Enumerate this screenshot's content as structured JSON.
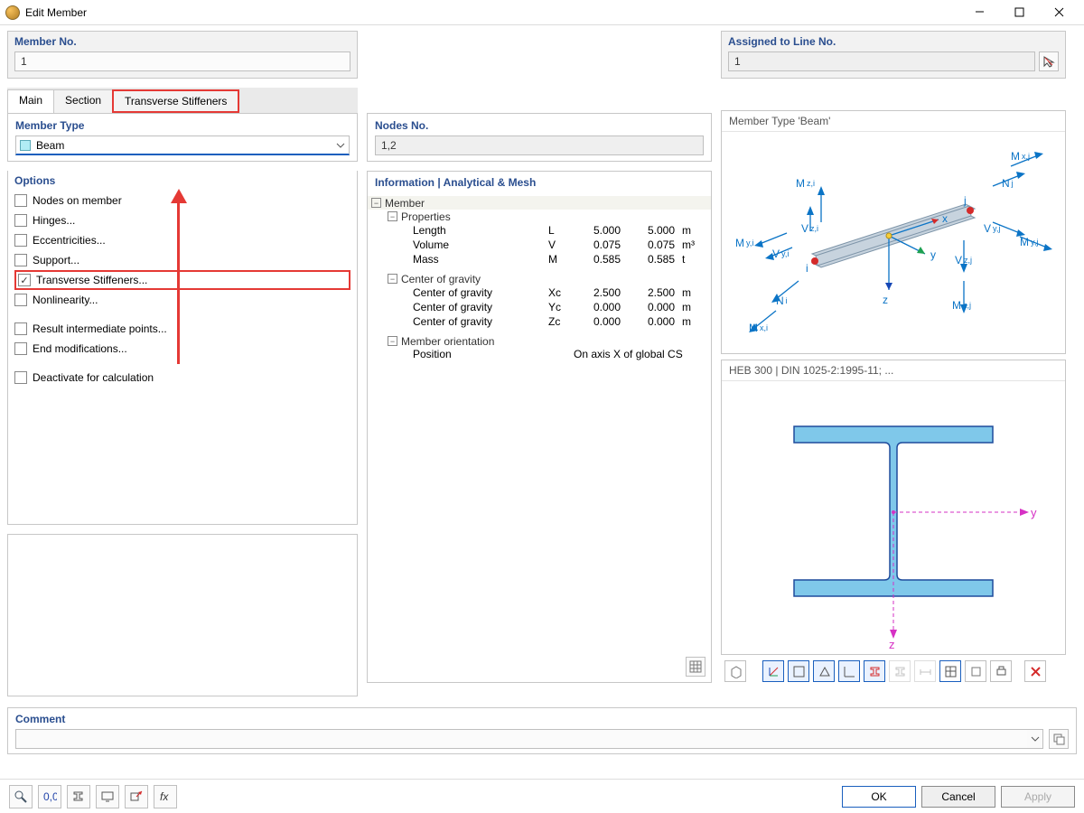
{
  "window": {
    "title": "Edit Member"
  },
  "member_no": {
    "title": "Member No.",
    "value": "1"
  },
  "assigned": {
    "title": "Assigned to Line No.",
    "value": "1"
  },
  "tabs": {
    "main": "Main",
    "section": "Section",
    "stiff": "Transverse Stiffeners"
  },
  "member_type": {
    "title": "Member Type",
    "value": "Beam"
  },
  "options": {
    "title": "Options",
    "nodes_on_member": "Nodes on member",
    "hinges": "Hinges...",
    "eccentricities": "Eccentricities...",
    "support": "Support...",
    "transverse_stiffeners": "Transverse Stiffeners...",
    "nonlinearity": "Nonlinearity...",
    "result_intermediate": "Result intermediate points...",
    "end_modifications": "End modifications...",
    "deactivate": "Deactivate for calculation"
  },
  "nodes_no": {
    "title": "Nodes No.",
    "value": "1,2"
  },
  "info": {
    "title": "Information | Analytical & Mesh",
    "member": "Member",
    "properties": "Properties",
    "length": "Length",
    "length_sym": "L",
    "length_v1": "5.000",
    "length_v2": "5.000",
    "length_u": "m",
    "volume": "Volume",
    "volume_sym": "V",
    "volume_v1": "0.075",
    "volume_v2": "0.075",
    "volume_u": "m³",
    "mass": "Mass",
    "mass_sym": "M",
    "mass_v1": "0.585",
    "mass_v2": "0.585",
    "mass_u": "t",
    "cog": "Center of gravity",
    "xc": "Xc",
    "yc": "Yc",
    "zc": "Zc",
    "cog_x1": "2.500",
    "cog_x2": "2.500",
    "cog_xu": "m",
    "cog_y1": "0.000",
    "cog_y2": "0.000",
    "cog_yu": "m",
    "cog_z1": "0.000",
    "cog_z2": "0.000",
    "cog_zu": "m",
    "orientation": "Member orientation",
    "position_lbl": "Position",
    "position_val": "On axis X of global CS"
  },
  "preview1": {
    "title": "Member Type 'Beam'",
    "Mzi": "M",
    "Mzisub": "z,i",
    "Vzi": "V",
    "Vzisub": "z,i",
    "Myi": "M",
    "Myisub": "y,i",
    "Vyi": "V",
    "Vyisub": "y,i",
    "Ni": "N",
    "Nisub": "i",
    "Mxi": "M",
    "Mxisub": "x,i",
    "Mxj": "M",
    "Mxjsub": "x,j",
    "Nj": "N",
    "Njsub": "j",
    "Vyj": "V",
    "Vyjsub": "y,j",
    "Myj": "M",
    "Myjsub": "y,j",
    "Vzj": "V",
    "Vzjsub": "z,j",
    "Mzj": "M",
    "Mzjsub": "z,j",
    "x": "x",
    "y": "y",
    "z": "z",
    "i": "i",
    "j": "j"
  },
  "preview2": {
    "title": "HEB 300 | DIN 1025-2:1995-11; ...",
    "y": "y",
    "z": "z"
  },
  "comment": {
    "title": "Comment",
    "value": ""
  },
  "buttons": {
    "ok": "OK",
    "cancel": "Cancel",
    "apply": "Apply"
  }
}
